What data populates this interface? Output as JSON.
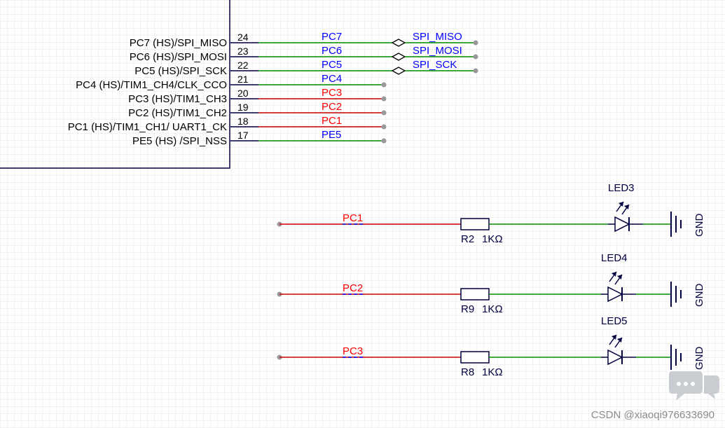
{
  "mcu_pins": [
    {
      "label": "PC7 (HS)/SPI_MISO",
      "number": "24",
      "net": "PC7",
      "net_color": "#0000ff",
      "wire_color": "#009000",
      "port": "SPI_MISO"
    },
    {
      "label": "PC6 (HS)/SPI_MOSI",
      "number": "23",
      "net": "PC6",
      "net_color": "#0000ff",
      "wire_color": "#009000",
      "port": "SPI_MOSI"
    },
    {
      "label": "PC5 (HS)/SPI_SCK",
      "number": "22",
      "net": "PC5",
      "net_color": "#0000ff",
      "wire_color": "#009000",
      "port": "SPI_SCK"
    },
    {
      "label": "PC4 (HS)/TIM1_CH4/CLK_CCO",
      "number": "21",
      "net": "PC4",
      "net_color": "#0000ff",
      "wire_color": "#009000",
      "port": ""
    },
    {
      "label": "PC3 (HS)/TIM1_CH3",
      "number": "20",
      "net": "PC3",
      "net_color": "#ff0000",
      "wire_color": "#cc0000",
      "port": ""
    },
    {
      "label": "PC2 (HS)/TIM1_CH2",
      "number": "19",
      "net": "PC2",
      "net_color": "#ff0000",
      "wire_color": "#cc0000",
      "port": ""
    },
    {
      "label": "PC1 (HS)/TIM1_CH1/ UART1_CK",
      "number": "18",
      "net": "PC1",
      "net_color": "#ff0000",
      "wire_color": "#cc0000",
      "port": ""
    },
    {
      "label": "PE5 (HS) /SPI_NSS",
      "number": "17",
      "net": "PE5",
      "net_color": "#0000ff",
      "wire_color": "#009000",
      "port": ""
    }
  ],
  "led_circuits": [
    {
      "net": "PC1",
      "resistor": "R2",
      "resistor_value": "1KΩ",
      "led": "LED3",
      "ground": "GND"
    },
    {
      "net": "PC2",
      "resistor": "R9",
      "resistor_value": "1KΩ",
      "led": "LED4",
      "ground": "GND"
    },
    {
      "net": "PC3",
      "resistor": "R8",
      "resistor_value": "1KΩ",
      "led": "LED5",
      "ground": "GND"
    }
  ],
  "colors": {
    "grid": "#e6e6e6",
    "component": "#000040",
    "net_blue": "#0000ff",
    "net_red": "#ff0000",
    "wire_green": "#009000",
    "wire_red": "#cc0000",
    "junction": "#999999"
  },
  "watermark": "CSDN @xiaoqi976633690",
  "chat_icon": "chat-bubble-icon"
}
